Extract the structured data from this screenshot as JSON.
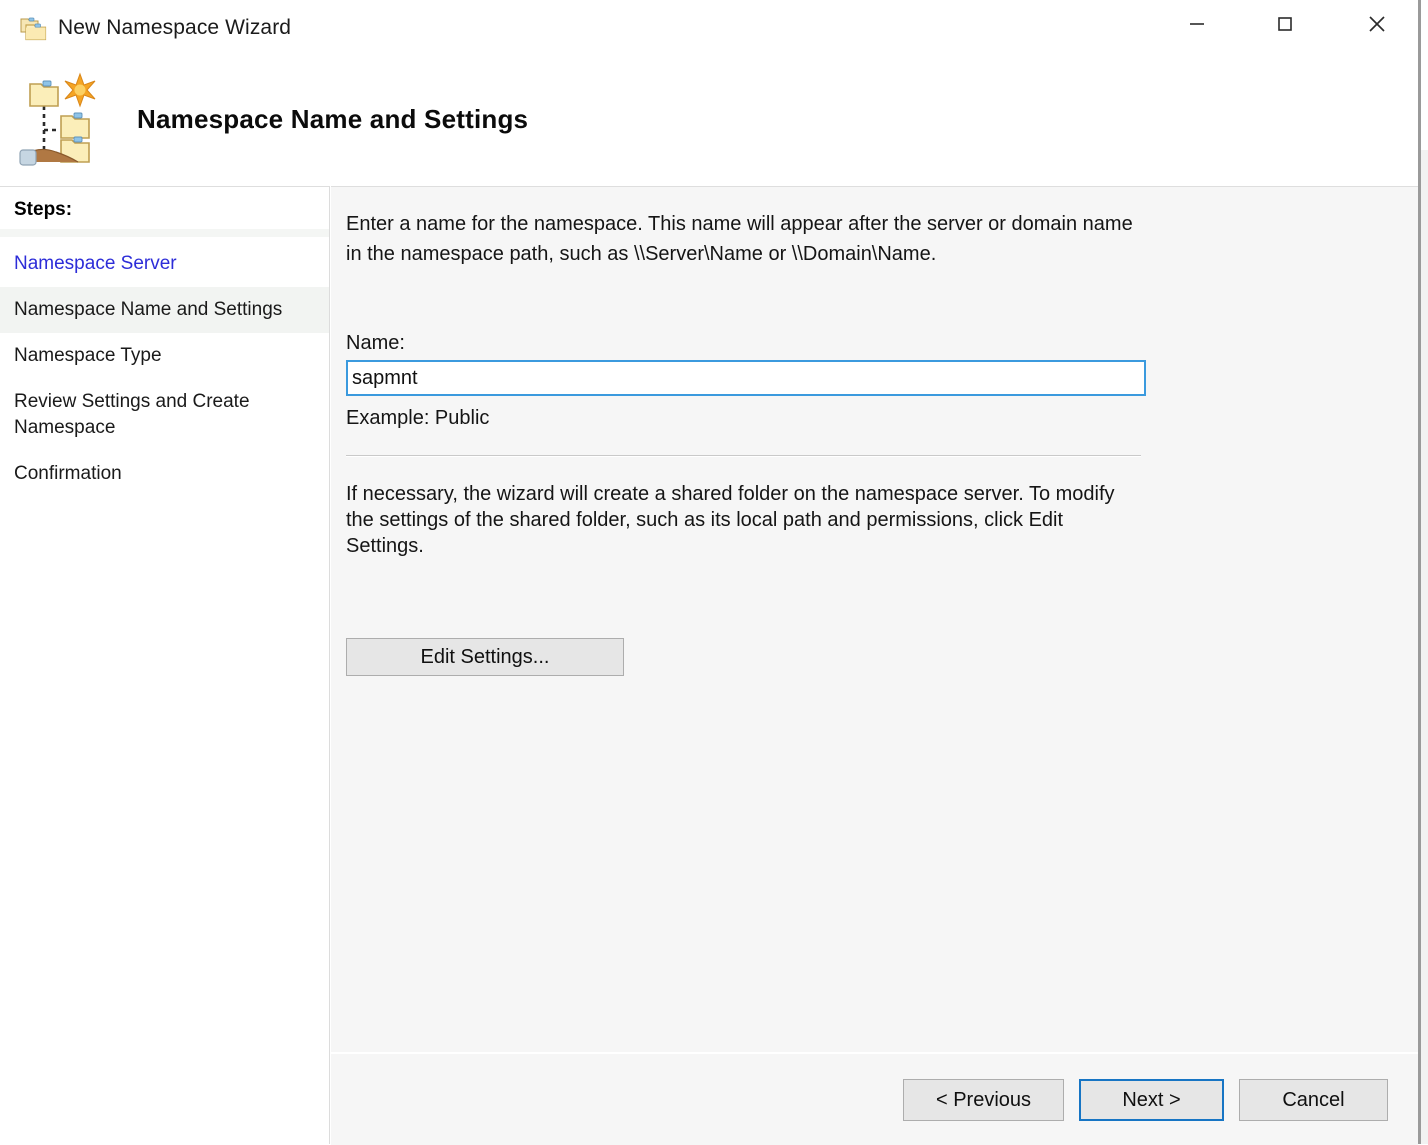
{
  "window": {
    "title": "New Namespace Wizard",
    "title_icon": "namespace-folders-icon",
    "controls": {
      "minimize": "minimize-icon",
      "maximize": "maximize-icon",
      "close": "close-icon"
    }
  },
  "header": {
    "icon": "namespace-tree-share-icon",
    "title": "Namespace Name and Settings"
  },
  "sidebar": {
    "heading": "Steps:",
    "items": [
      {
        "label": "Namespace Server",
        "state": "completed"
      },
      {
        "label": "Namespace Name and Settings",
        "state": "current"
      },
      {
        "label": "Namespace Type",
        "state": "pending"
      },
      {
        "label": "Review Settings and Create Namespace",
        "state": "pending"
      },
      {
        "label": "Confirmation",
        "state": "pending"
      }
    ]
  },
  "main": {
    "intro_text": "Enter a name for the namespace. This name will appear after the server or domain name in the namespace path, such as \\\\Server\\Name or \\\\Domain\\Name.",
    "name_label": "Name:",
    "name_value": "sapmnt",
    "name_placeholder": "",
    "example_text": "Example: Public",
    "share_text": "If necessary, the wizard will create a shared folder on the namespace server. To modify the settings of the shared folder, such as its local path and permissions, click Edit Settings.",
    "edit_settings_label": "Edit Settings..."
  },
  "footer": {
    "previous_label": "< Previous",
    "next_label": "Next >",
    "cancel_label": "Cancel",
    "default_button": "Next >"
  },
  "colors": {
    "accent_focus": "#3b9ade",
    "default_button_border": "#1775c4",
    "link": "#2d2dd8",
    "content_bg": "#f6f6f6",
    "sidebar_bg": "#ffffff",
    "current_step_bg": "#f2f4f2"
  }
}
